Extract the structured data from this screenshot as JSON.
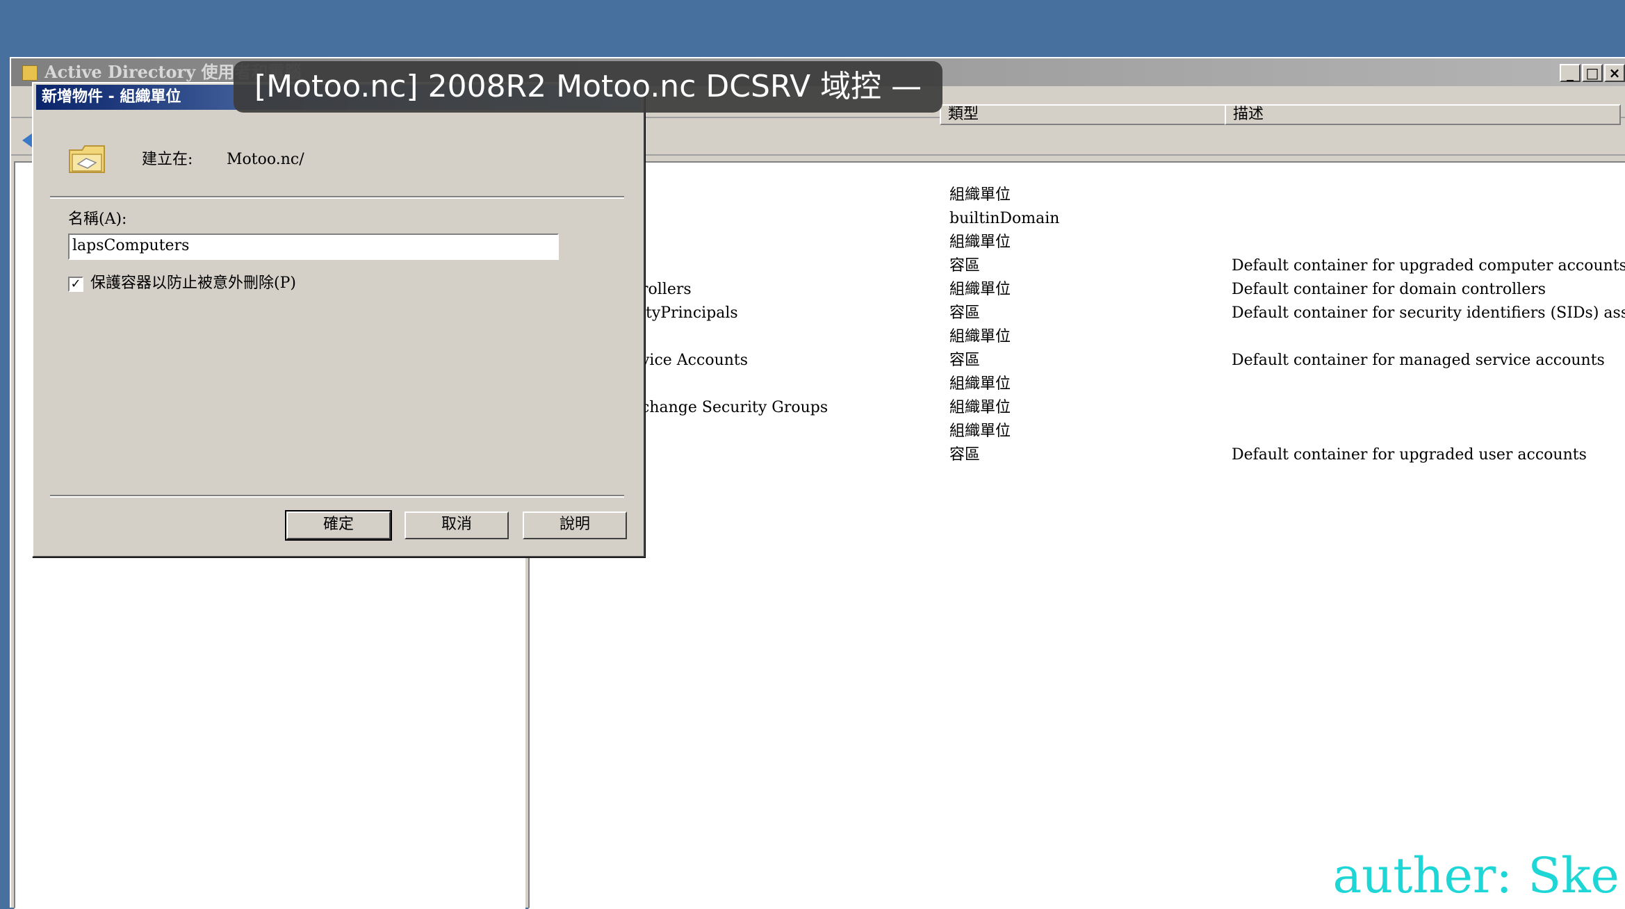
{
  "main_window": {
    "title": "Active Directory 使用者和電腦",
    "caption_buttons": {
      "minimize": "_",
      "maximize": "□",
      "close": "×"
    }
  },
  "list": {
    "columns": {
      "type": "類型",
      "description": "描述"
    },
    "rows": [
      {
        "name": "",
        "type": "組織單位",
        "description": ""
      },
      {
        "name": "",
        "type": "builtinDomain",
        "description": ""
      },
      {
        "name": "",
        "type": "組織單位",
        "description": ""
      },
      {
        "name": "",
        "type": "容區",
        "description": "Default container for upgraded computer accounts"
      },
      {
        "name": "rollers",
        "type": "組織單位",
        "description": "Default container for domain controllers"
      },
      {
        "name": "ityPrincipals",
        "type": "容區",
        "description": "Default container for security identifiers (SIDs) associate..."
      },
      {
        "name": "",
        "type": "組織單位",
        "description": ""
      },
      {
        "name": "vice Accounts",
        "type": "容區",
        "description": "Default container for managed service accounts"
      },
      {
        "name": "",
        "type": "組織單位",
        "description": ""
      },
      {
        "name": "change Security Groups",
        "type": "組織單位",
        "description": ""
      },
      {
        "name": "",
        "type": "組織單位",
        "description": ""
      },
      {
        "name": "",
        "type": "容區",
        "description": "Default container for upgraded user accounts"
      }
    ]
  },
  "dialog": {
    "title": "新增物件 - 組織單位",
    "create_in_label": "建立在:",
    "create_in_value": "Motoo.nc/",
    "name_label": "名稱(A):",
    "name_value": "lapsComputers",
    "protect_checkbox_label": "保護容器以防止被意外刪除(P)",
    "protect_checked": true,
    "buttons": {
      "ok": "確定",
      "cancel": "取消",
      "help": "說明"
    }
  },
  "overlay": {
    "video_title": "[Motoo.nc] 2008R2 Motoo.nc DCSRV 域控 —",
    "watermark": "auther: Ske"
  },
  "colors": {
    "desktop": "#48709f",
    "dialog_title_bar": "#0a246a",
    "watermark": "#1fd6d6"
  }
}
